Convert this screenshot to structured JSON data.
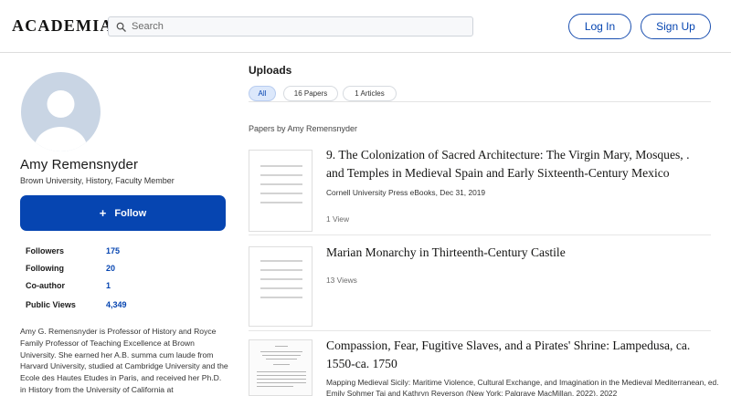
{
  "header": {
    "logo": "ACADEMIA",
    "search_placeholder": "Search",
    "login_label": "Log In",
    "signup_label": "Sign Up"
  },
  "colors": {
    "accent": "#0645b1",
    "avatar_bg": "#c9d5e4",
    "active_filter_bg": "#dce8fb"
  },
  "profile": {
    "name": "Amy Remensnyder",
    "affiliation": "Brown University, History, Faculty Member",
    "follow_label": "Follow",
    "stats": [
      {
        "label": "Followers",
        "value": "175"
      },
      {
        "label": "Following",
        "value": "20"
      },
      {
        "label": "Co-author",
        "value": "1"
      },
      {
        "label": "Public Views",
        "value": "4,349"
      }
    ],
    "bio": "Amy G. Remensnyder is Professor of History and Royce Family Professor of Teaching Excellence at Brown University.  She earned her A.B. summa cum laude from Harvard University, studied at Cambridge University and the Ecole des Hautes Etudes in Paris, and received her Ph.D. in History from the University of California at"
  },
  "uploads": {
    "title": "Uploads",
    "filters": [
      {
        "label": "All",
        "active": true
      },
      {
        "label": "16 Papers",
        "active": false
      },
      {
        "label": "1 Articles",
        "active": false
      }
    ],
    "section_label": "Papers by Amy Remensnyder",
    "papers": [
      {
        "title": "9. The Colonization of Sacred Architecture: The Virgin Mary, Mosques, . and Temples in Medieval Spain and Early Sixteenth-Century Mexico",
        "meta": "Cornell University Press eBooks, Dec 31, 2019",
        "views": "1 View"
      },
      {
        "title": "Marian Monarchy in Thirteenth-Century Castile",
        "meta": "",
        "views": "13 Views"
      },
      {
        "title": "Compassion, Fear, Fugitive Slaves, and a Pirates' Shrine: Lampedusa, ca. 1550-ca. 1750",
        "meta": "Mapping Medieval Sicily: Maritime Violence, Cultural Exchange, and Imagination in the Medieval Mediterranean, ed. Emily Sohmer Tai and Kathryn Reverson (New York: Palgrave MacMillan, 2022), 2022",
        "views": ""
      }
    ]
  }
}
